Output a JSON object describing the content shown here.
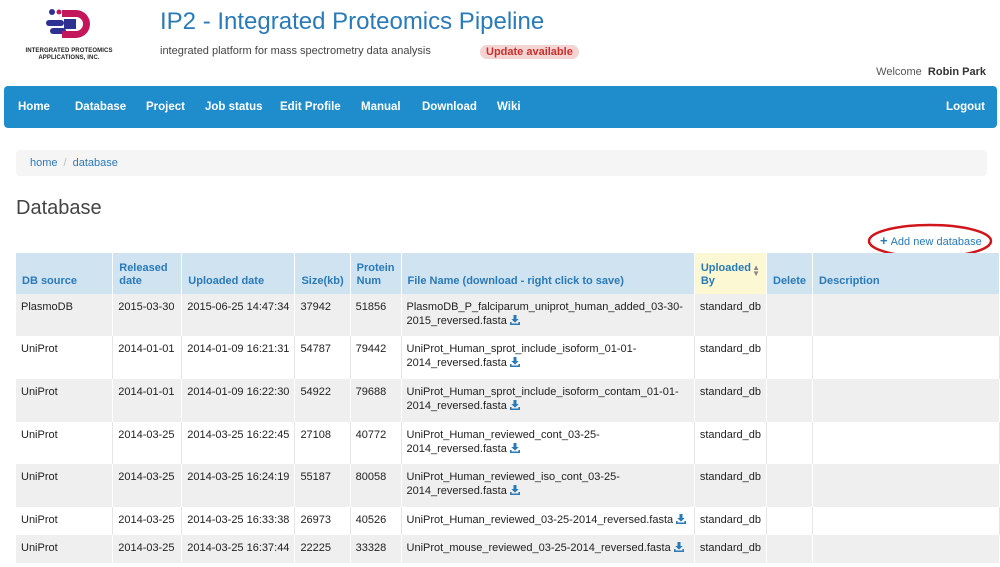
{
  "header": {
    "logo_text_line1": "INTERGRATED PROTEOMICS",
    "logo_text_line2": "APPLICATIONS, INC.",
    "title": "IP2 - Integrated Proteomics Pipeline",
    "subtitle": "integrated platform for mass spectrometry data analysis",
    "update_badge": "Update available",
    "welcome_label": "Welcome",
    "user_name": "Robin Park"
  },
  "nav": {
    "items": [
      "Home",
      "Database",
      "Project",
      "Job status",
      "Edit Profile",
      "Manual",
      "Download",
      "Wiki"
    ],
    "logout": "Logout"
  },
  "breadcrumb": {
    "home": "home",
    "separator": "/",
    "current": "database"
  },
  "page": {
    "title": "Database",
    "add_new": "Add new database"
  },
  "table": {
    "columns": [
      "DB source",
      "Released date",
      "Uploaded date",
      "Size(kb)",
      "Protein Num",
      "File Name (download - right click to save)",
      "Uploaded By",
      "Delete",
      "Description"
    ],
    "rows": [
      [
        "PlasmoDB",
        "2015-03-30",
        "2015-06-25 14:47:34",
        "37942",
        "51856",
        "PlasmoDB_P_falciparum_uniprot_human_added_03-30-2015_reversed.fasta",
        "standard_db",
        "",
        ""
      ],
      [
        "UniProt",
        "2014-01-01",
        "2014-01-09 16:21:31",
        "54787",
        "79442",
        "UniProt_Human_sprot_include_isoform_01-01-2014_reversed.fasta",
        "standard_db",
        "",
        ""
      ],
      [
        "UniProt",
        "2014-01-01",
        "2014-01-09 16:22:30",
        "54922",
        "79688",
        "UniProt_Human_sprot_include_isoform_contam_01-01-2014_reversed.fasta",
        "standard_db",
        "",
        ""
      ],
      [
        "UniProt",
        "2014-03-25",
        "2014-03-25 16:22:45",
        "27108",
        "40772",
        "UniProt_Human_reviewed_cont_03-25-2014_reversed.fasta",
        "standard_db",
        "",
        ""
      ],
      [
        "UniProt",
        "2014-03-25",
        "2014-03-25 16:24:19",
        "55187",
        "80058",
        "UniProt_Human_reviewed_iso_cont_03-25-2014_reversed.fasta",
        "standard_db",
        "",
        ""
      ],
      [
        "UniProt",
        "2014-03-25",
        "2014-03-25 16:33:38",
        "26973",
        "40526",
        "UniProt_Human_reviewed_03-25-2014_reversed.fasta",
        "standard_db",
        "",
        ""
      ],
      [
        "UniProt",
        "2014-03-25",
        "2014-03-25 16:37:44",
        "22225",
        "33328",
        "UniProt_mouse_reviewed_03-25-2014_reversed.fasta",
        "standard_db",
        "",
        ""
      ]
    ]
  },
  "colors": {
    "brand_blue": "#2a7ab8",
    "navbar": "#1f8ccc",
    "header_row": "#cfe3f1",
    "sorted_header": "#fcf8d3",
    "highlight_ring": "#d0161b",
    "update_badge_text": "#c9302c"
  },
  "icons": {
    "download": "download-icon",
    "add": "plus-icon",
    "sort": "sort-icon",
    "logo": "ip2-logo"
  }
}
